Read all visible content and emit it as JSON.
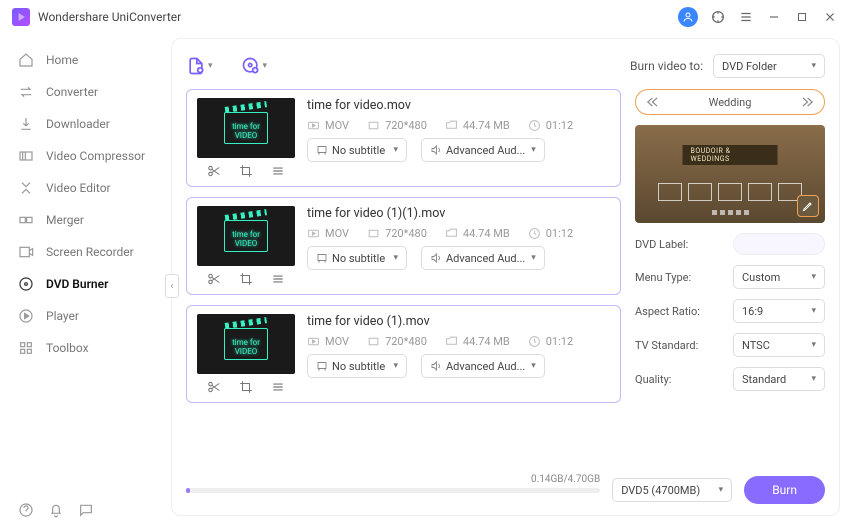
{
  "titlebar": {
    "app_name": "Wondershare UniConverter"
  },
  "sidebar": {
    "items": [
      {
        "label": "Home"
      },
      {
        "label": "Converter"
      },
      {
        "label": "Downloader"
      },
      {
        "label": "Video Compressor"
      },
      {
        "label": "Video Editor"
      },
      {
        "label": "Merger"
      },
      {
        "label": "Screen Recorder"
      },
      {
        "label": "DVD Burner"
      },
      {
        "label": "Player"
      },
      {
        "label": "Toolbox"
      }
    ]
  },
  "topbar": {
    "burn_to_label": "Burn video to:",
    "burn_to_value": "DVD Folder"
  },
  "files": [
    {
      "name": "time for video.mov",
      "format": "MOV",
      "resolution": "720*480",
      "size": "44.74 MB",
      "duration": "01:12",
      "subtitle": "No subtitle",
      "audio": "Advanced Aud..."
    },
    {
      "name": "time for video (1)(1).mov",
      "format": "MOV",
      "resolution": "720*480",
      "size": "44.74 MB",
      "duration": "01:12",
      "subtitle": "No subtitle",
      "audio": "Advanced Aud..."
    },
    {
      "name": "time for video (1).mov",
      "format": "MOV",
      "resolution": "720*480",
      "size": "44.74 MB",
      "duration": "01:12",
      "subtitle": "No subtitle",
      "audio": "Advanced Aud..."
    }
  ],
  "template": {
    "name": "Wedding",
    "banner": "BOUDOIR & WEDDINGS"
  },
  "settings": {
    "dvd_label_label": "DVD Label:",
    "dvd_label_value": "",
    "menu_type_label": "Menu Type:",
    "menu_type_value": "Custom",
    "aspect_label": "Aspect Ratio:",
    "aspect_value": "16:9",
    "tv_label": "TV Standard:",
    "tv_value": "NTSC",
    "quality_label": "Quality:",
    "quality_value": "Standard"
  },
  "footer": {
    "progress_text": "0.14GB/4.70GB",
    "disc_value": "DVD5 (4700MB)",
    "burn_label": "Burn"
  },
  "thumb_text_top": "time for",
  "thumb_text_bottom": "VIDEO"
}
